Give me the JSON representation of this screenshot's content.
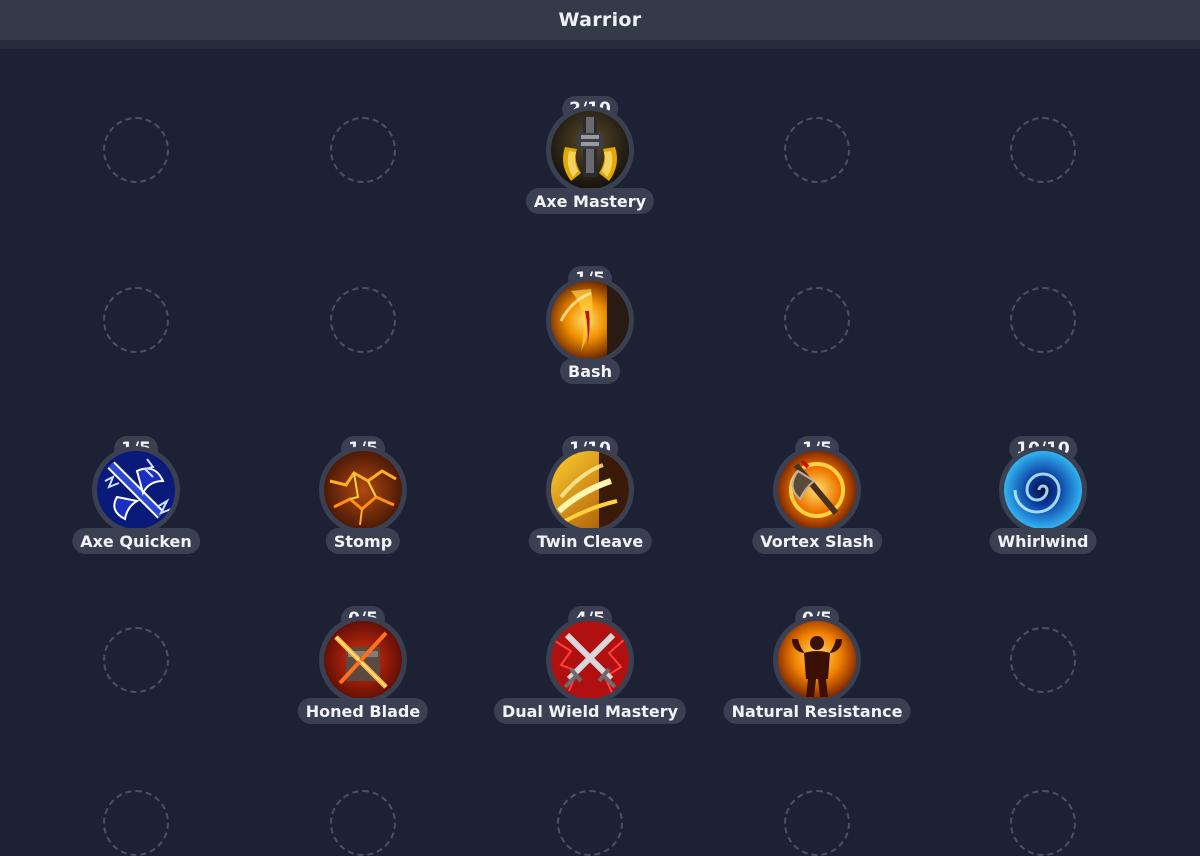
{
  "window": {
    "title": "Warrior"
  },
  "skills": {
    "axe_mastery": {
      "name": "Axe Mastery",
      "rank": "2/10",
      "icon": "axe-mastery-icon"
    },
    "bash": {
      "name": "Bash",
      "rank": "1/5",
      "icon": "bash-icon"
    },
    "axe_quicken": {
      "name": "Axe Quicken",
      "rank": "1/5",
      "icon": "axe-quicken-icon"
    },
    "stomp": {
      "name": "Stomp",
      "rank": "1/5",
      "icon": "stomp-icon"
    },
    "twin_cleave": {
      "name": "Twin Cleave",
      "rank": "1/10",
      "icon": "twin-cleave-icon"
    },
    "vortex_slash": {
      "name": "Vortex Slash",
      "rank": "1/5",
      "icon": "vortex-slash-icon"
    },
    "whirlwind": {
      "name": "Whirlwind",
      "rank": "10/10",
      "icon": "whirlwind-icon"
    },
    "honed_blade": {
      "name": "Honed Blade",
      "rank": "0/5",
      "icon": "honed-blade-icon"
    },
    "dual_wield_mastery": {
      "name": "Dual Wield Mastery",
      "rank": "4/5",
      "icon": "dual-wield-mastery-icon"
    },
    "natural_resistance": {
      "name": "Natural Resistance",
      "rank": "0/5",
      "icon": "natural-resistance-icon"
    }
  },
  "colors": {
    "background": "#1c2233",
    "header": "#343a4a",
    "pill": "#3a4052",
    "empty_slot_border": "#4a5166"
  }
}
